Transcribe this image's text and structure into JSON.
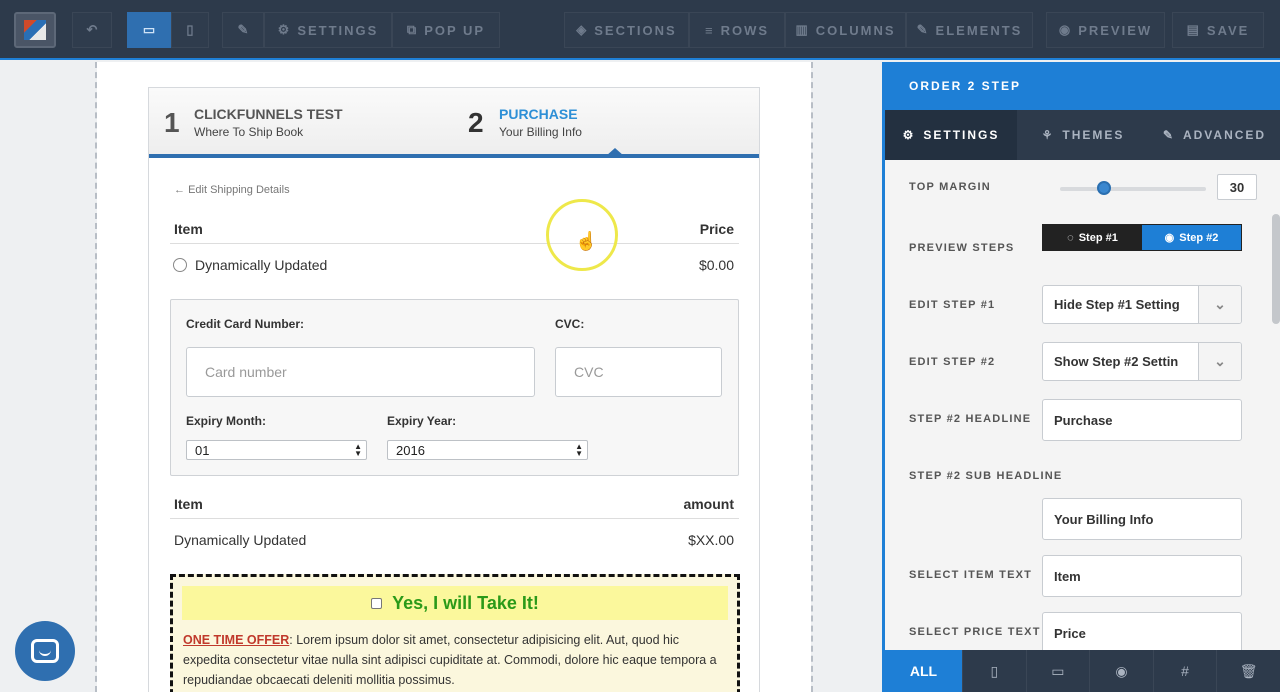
{
  "toolbar": {
    "settings_label": "SETTINGS",
    "popup_label": "POP UP",
    "sections_label": "SECTIONS",
    "rows_label": "ROWS",
    "columns_label": "COLUMNS",
    "elements_label": "ELEMENTS",
    "preview_label": "PREVIEW",
    "save_label": "SAVE"
  },
  "order_form": {
    "step1": {
      "number": "1",
      "title": "CLICKFUNNELS TEST",
      "subtitle": "Where To Ship Book"
    },
    "step2": {
      "number": "2",
      "title": "PURCHASE",
      "subtitle": "Your Billing Info"
    },
    "edit_shipping": "Edit Shipping Details",
    "item_header": "Item",
    "price_header": "Price",
    "product_name": "Dynamically Updated",
    "product_price": "$0.00",
    "card_label": "Credit Card Number:",
    "cvc_label": "CVC:",
    "card_placeholder": "Card number",
    "cvc_placeholder": "CVC",
    "expiry_month_label": "Expiry Month:",
    "expiry_year_label": "Expiry Year:",
    "expiry_month_value": "01",
    "expiry_year_value": "2016",
    "summary_item_header": "Item",
    "summary_amount_header": "amount",
    "summary_item": "Dynamically Updated",
    "summary_amount": "$XX.00",
    "bump_headline": "Yes, I will Take It!",
    "bump_offer_label": "ONE TIME OFFER",
    "bump_offer_text": ": Lorem ipsum dolor sit amet, consectetur adipisicing elit. Aut, quod hic expedita consectetur vitae nulla sint adipisci cupiditate at. Commodi, dolore hic eaque tempora a repudiandae obcaecati deleniti mollitia possimus."
  },
  "panel": {
    "title": "ORDER 2 STEP",
    "tabs": [
      "SETTINGS",
      "THEMES",
      "ADVANCED"
    ],
    "top_margin_label": "TOP MARGIN",
    "top_margin_value": "30",
    "top_margin_slider_fraction": 0.3,
    "preview_steps_label": "PREVIEW STEPS",
    "preview_step1": "Step #1",
    "preview_step2": "Step #2",
    "edit_step1_label": "EDIT STEP #1",
    "edit_step1_value": "Hide Step #1 Setting",
    "edit_step2_label": "EDIT STEP #2",
    "edit_step2_value": "Show Step #2 Settin",
    "step2_headline_label": "STEP #2 HEADLINE",
    "step2_headline_value": "Purchase",
    "step2_sub_label": "STEP #2 SUB HEADLINE",
    "step2_sub_value": "Your Billing Info",
    "select_item_label": "SELECT ITEM TEXT",
    "select_item_value": "Item",
    "select_price_label": "SELECT PRICE TEXT",
    "select_price_value": "Price",
    "bottom_all": "ALL"
  },
  "colors": {
    "accent": "#1e7fd6",
    "toolbar_bg": "#2d3a4b",
    "bump_green": "#2a9a19",
    "offer_red": "#c0392b"
  }
}
